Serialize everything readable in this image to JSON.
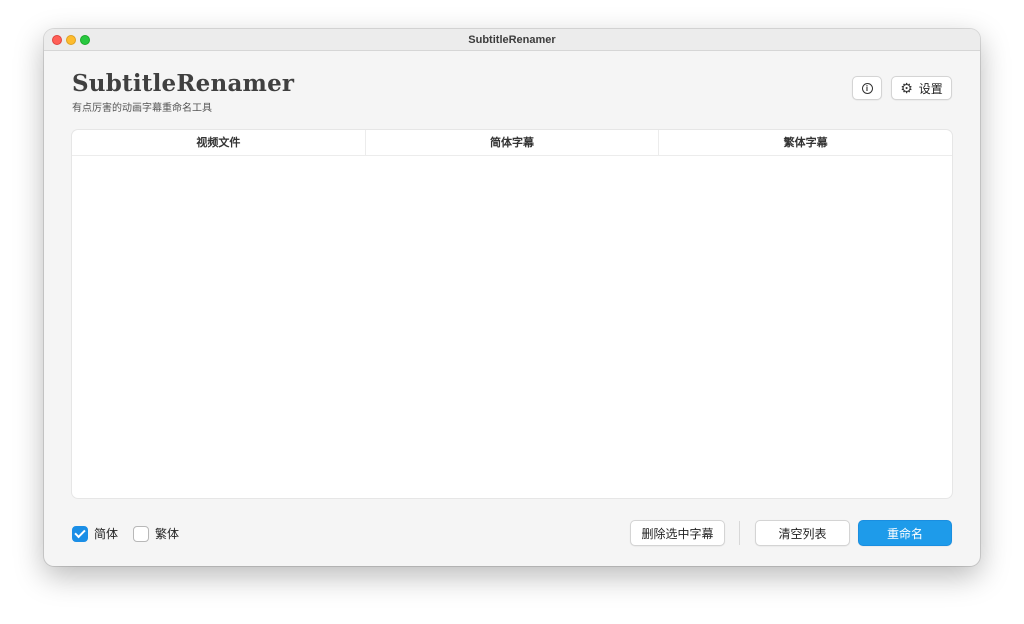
{
  "window": {
    "title": "SubtitleRenamer"
  },
  "header": {
    "app_title": "SubtitleRenamer",
    "app_subtitle": "有点厉害的动画字幕重命名工具",
    "info_button_glyph": "i",
    "settings_label": "设置"
  },
  "table": {
    "columns": [
      "视频文件",
      "简体字幕",
      "繁体字幕"
    ],
    "rows": []
  },
  "footer": {
    "checkbox_simplified": {
      "label": "简体",
      "checked": true
    },
    "checkbox_traditional": {
      "label": "繁体",
      "checked": false
    },
    "delete_label": "删除选中字幕",
    "clear_label": "清空列表",
    "rename_label": "重命名"
  },
  "icons": {
    "info": "info-icon",
    "settings": "gear-icon",
    "checkmark": "checkmark-icon"
  },
  "colors": {
    "accent": "#1e9bea",
    "traffic_close": "#ff5f57",
    "traffic_minimize": "#febc2e",
    "traffic_maximize": "#28c840",
    "window_background": "#f5f5f5"
  }
}
